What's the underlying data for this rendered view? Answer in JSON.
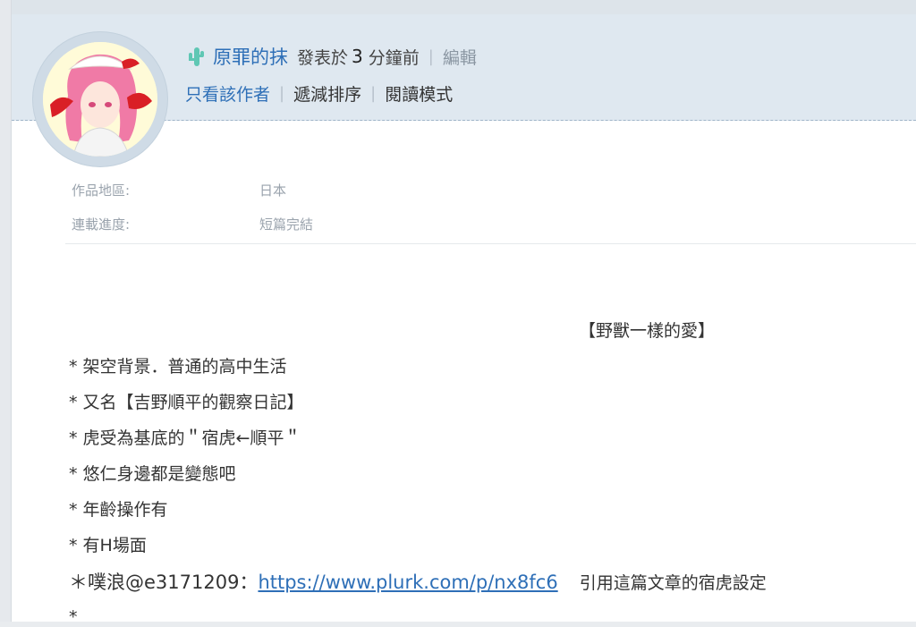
{
  "post_header": {
    "author_name": "原罪的抹",
    "posted_prefix": "發表於",
    "posted_number": "3",
    "posted_suffix": "分鐘前",
    "edit_label": "編輯",
    "actions": [
      "只看該作者",
      "遞減排序",
      "閱讀模式"
    ]
  },
  "post_info": [
    {
      "label": "作品地區:",
      "value": "日本"
    },
    {
      "label": "連載進度:",
      "value": "短篇完結"
    }
  ],
  "content": {
    "title": "【野獸一樣的愛】",
    "bullets": [
      "* 架空背景．普通的高中生活",
      "* 又名【吉野順平的觀察日記】",
      "* 虎受為基底的＂宿虎←順平＂",
      "* 悠仁身邊都是變態吧",
      "* 年齡操作有",
      "* 有H場面"
    ],
    "plurk_prefix": "＊噗浪@e3171209：",
    "plurk_url": "https://www.plurk.com/p/nx8fc6",
    "plurk_suffix": "引用這篇文章的宿虎設定",
    "last_line": "*"
  },
  "colors": {
    "header_bg": "#dfe8f0",
    "link": "#2e6fb7",
    "muted": "#9aa3ad"
  }
}
